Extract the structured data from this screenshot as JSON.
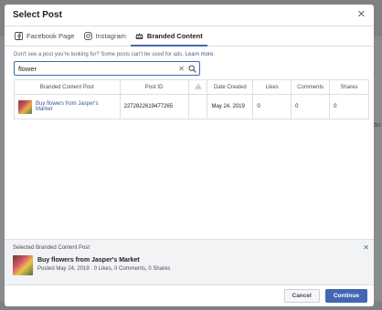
{
  "modal": {
    "title": "Select Post",
    "close_glyph": "✕"
  },
  "tabs": [
    {
      "label": "Facebook Page",
      "icon": "facebook-icon",
      "active": false
    },
    {
      "label": "Instagram",
      "icon": "instagram-icon",
      "active": false
    },
    {
      "label": "Branded Content",
      "icon": "branded-content-icon",
      "active": true
    }
  ],
  "hint": {
    "text": "Don't see a post you're looking for? Some posts can't be used for ads.",
    "link": "Learn more."
  },
  "search": {
    "value": "flower",
    "clear_glyph": "✕"
  },
  "table": {
    "headers": {
      "post": "Branded Content Post",
      "post_id": "Post ID",
      "date": "Date Created",
      "likes": "Likes",
      "comments": "Comments",
      "shares": "Shares"
    },
    "rows": [
      {
        "post": "Buy flowers from Jasper's Market",
        "post_id": "2272822619477265",
        "date": "May 24, 2019",
        "likes": "0",
        "comments": "0",
        "shares": "0"
      }
    ]
  },
  "selected": {
    "heading": "Selected Branded Content Post",
    "name": "Buy flowers from Jasper's Market",
    "meta": "Posted May 24, 2019 . 0 Likes, 0 Comments, 0 Shares",
    "close_glyph": "✕"
  },
  "footer": {
    "cancel": "Cancel",
    "continue": "Continue"
  },
  "colors": {
    "accent": "#4267b2",
    "link": "#385898",
    "overlay": "#7f8083"
  },
  "background": {
    "partial_text": "ectu"
  }
}
